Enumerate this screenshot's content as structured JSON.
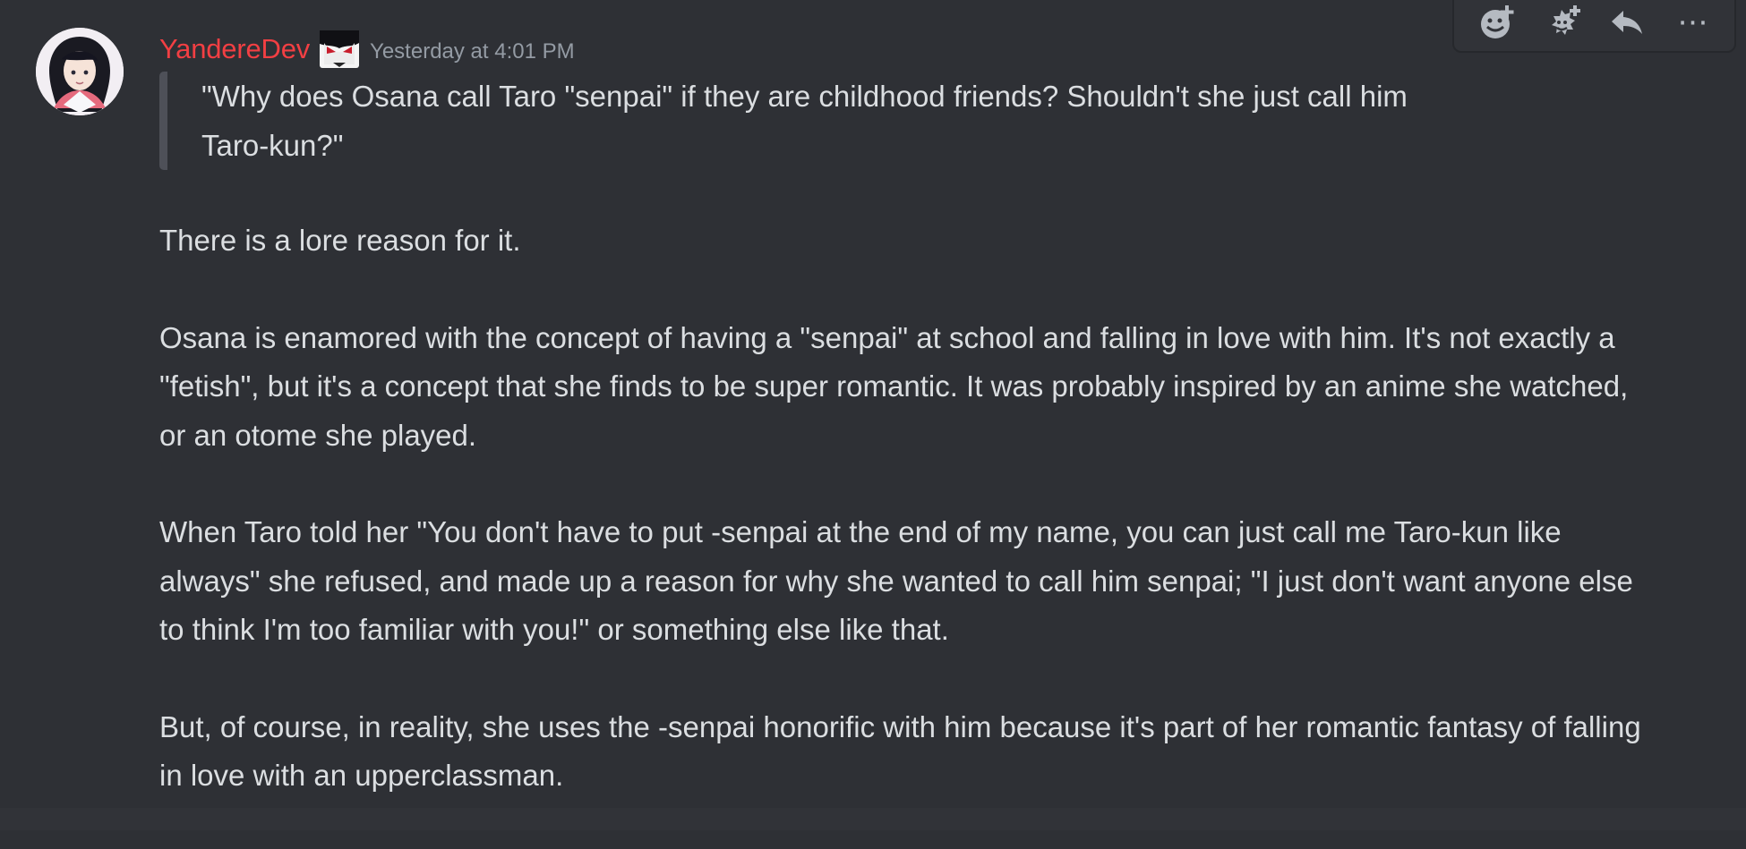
{
  "message": {
    "author": "YandereDev",
    "timestamp": "Yesterday at 4:01 PM",
    "quote": "\"Why does Osana call Taro \"senpai\" if they are childhood friends? Shouldn't she just call him Taro-kun?\"",
    "paragraphs": [
      "There is a lore reason for it.",
      "Osana is enamored with the concept of having a \"senpai\" at school and falling in love with him. It's not exactly a \"fetish\", but it's a concept that she finds to be super romantic. It was probably inspired by an anime she watched, or an otome she played.",
      "When Taro told her \"You don't have to put -senpai at the end of my name, you can just call me Taro-kun like always\" she refused, and made up a reason for why she wanted to call him senpai; \"I just don't want anyone else to think I'm too familiar with you!\" or something else like that.",
      "But, of course, in reality, she uses the -senpai honorific with him because it's part of her romantic fantasy of falling in love with an upperclassman."
    ]
  },
  "toolbar": {
    "more_label": "⋯"
  },
  "colors": {
    "background": "#2e3035",
    "username": "#f23f43",
    "timestamp": "#949ba4",
    "text": "#dbdee1",
    "quote_bar": "#4e5058",
    "icon": "#b5bac1"
  },
  "icons": {
    "avatar": "user-avatar",
    "role": "role-icon",
    "add_reaction": "add-reaction-icon",
    "add_super_reaction": "add-super-reaction-icon",
    "reply": "reply-icon",
    "more": "more-icon"
  }
}
